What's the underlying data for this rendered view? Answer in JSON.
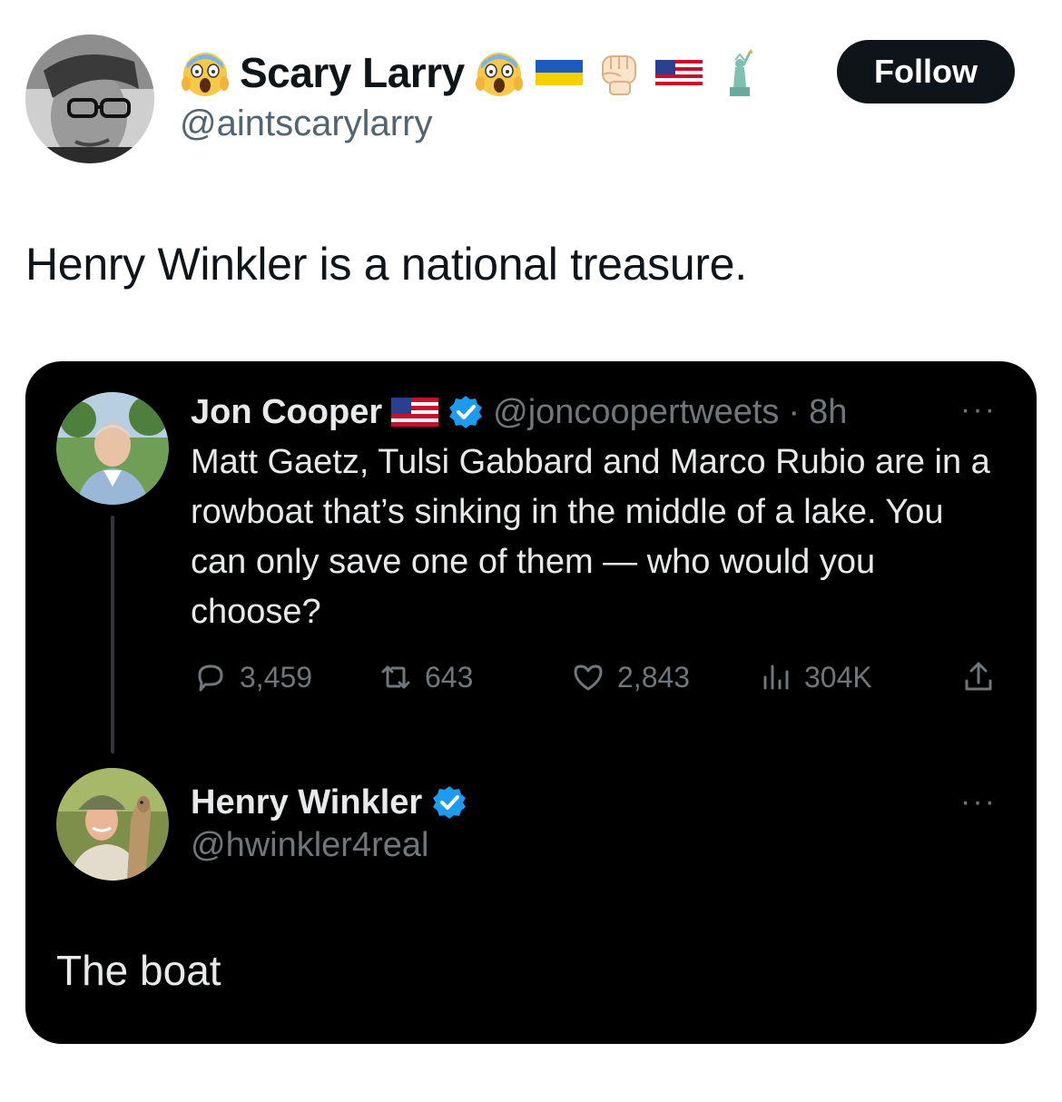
{
  "outer_tweet": {
    "display_name": "Scary Larry",
    "handle": "@aintscarylarry",
    "follow_label": "Follow",
    "text": "Henry Winkler is a national treasure.",
    "name_emojis": [
      "screaming-face-icon",
      "screaming-face-icon",
      "ukraine-flag-icon",
      "raised-fist-icon",
      "us-flag-icon",
      "statue-of-liberty-icon"
    ]
  },
  "quoted": {
    "original": {
      "display_name": "Jon Cooper",
      "handle": "@joncoopertweets",
      "separator": "·",
      "time": "8h",
      "more": "···",
      "text": "Matt Gaetz, Tulsi Gabbard and Marco Rubio are in a rowboat that’s sinking in the middle of a lake. You can only save one of them — who would you choose?",
      "stats": {
        "replies": "3,459",
        "reposts": "643",
        "likes": "2,843",
        "views": "304K"
      }
    },
    "reply": {
      "display_name": "Henry Winkler",
      "handle": "@hwinkler4real",
      "more": "···",
      "text": "The boat"
    }
  },
  "colors": {
    "card_background": "#000000",
    "verified_badge": "#1d9bf0",
    "follow_button": "#0f1419",
    "muted_text_dark": "#71767b",
    "muted_text_light": "#536471"
  }
}
